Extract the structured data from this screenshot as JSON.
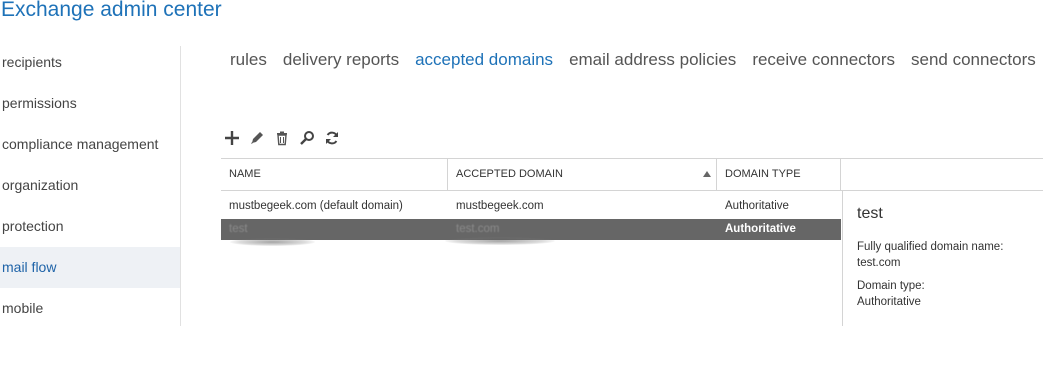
{
  "app": {
    "title": "Exchange admin center"
  },
  "sidebar": {
    "items": [
      {
        "label": "recipients"
      },
      {
        "label": "permissions"
      },
      {
        "label": "compliance management"
      },
      {
        "label": "organization"
      },
      {
        "label": "protection"
      },
      {
        "label": "mail flow",
        "selected": true
      },
      {
        "label": "mobile"
      }
    ]
  },
  "tabs": [
    {
      "label": "rules"
    },
    {
      "label": "delivery reports"
    },
    {
      "label": "accepted domains",
      "active": true
    },
    {
      "label": "email address policies"
    },
    {
      "label": "receive connectors"
    },
    {
      "label": "send connectors"
    }
  ],
  "toolbar": {
    "icons": [
      "add-icon",
      "edit-icon",
      "delete-icon",
      "search-icon",
      "refresh-icon"
    ]
  },
  "grid": {
    "columns": [
      {
        "label": "NAME"
      },
      {
        "label": "ACCEPTED DOMAIN",
        "sorted": "ascending"
      },
      {
        "label": "DOMAIN TYPE"
      }
    ],
    "rows": [
      {
        "name": "mustbegeek.com (default domain)",
        "domain": "mustbegeek.com",
        "type": "Authoritative",
        "selected": false
      },
      {
        "name": "test",
        "domain": "test.com",
        "type": "Authoritative",
        "selected": true
      }
    ]
  },
  "details": {
    "title": "test",
    "fqdn_label": "Fully qualified domain name:",
    "fqdn_value": "test.com",
    "type_label": "Domain type:",
    "type_value": "Authoritative"
  },
  "colors": {
    "accent": "#1e72b8",
    "selected_row": "#666666",
    "sidebar_selected": "#eef1f5"
  }
}
